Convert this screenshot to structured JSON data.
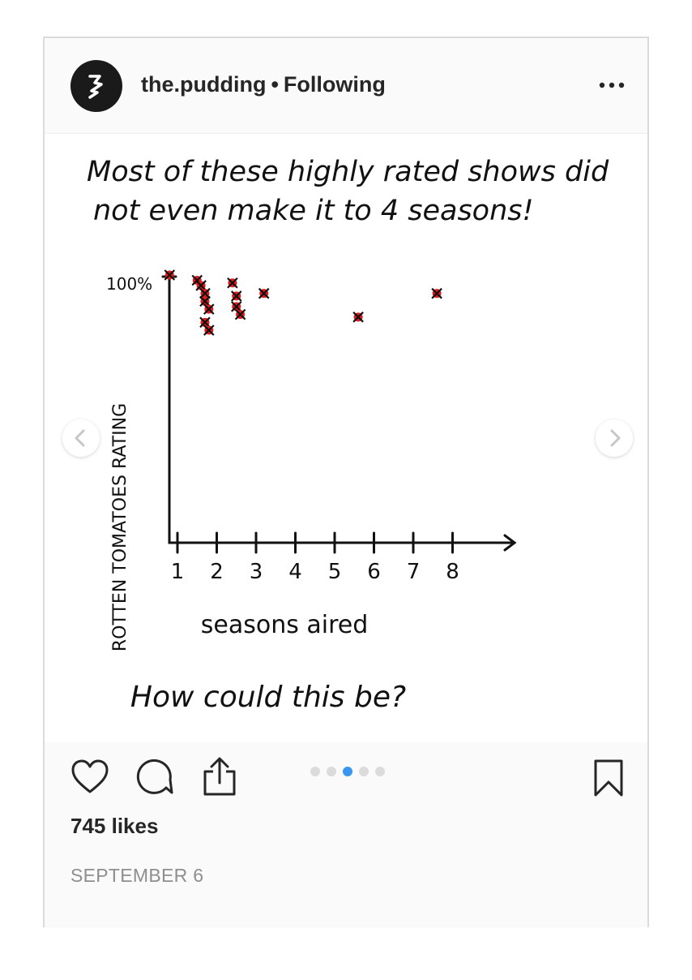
{
  "post": {
    "username": "the.pudding",
    "separator": "•",
    "follow_status": "Following",
    "likes": "745 likes",
    "date": "SEPTEMBER 6",
    "carousel": {
      "count": 5,
      "active_index": 2
    }
  },
  "image": {
    "title_line1": "Most of these highly rated shows did",
    "title_line2": "not even make it to 4 seasons!",
    "footer": "How could this be?"
  },
  "colors": {
    "accent": "#3897f0",
    "dot_red": "#e01b1b",
    "border": "#dbdbdb"
  },
  "icons": [
    "more-options-icon",
    "chevron-left-icon",
    "chevron-right-icon",
    "heart-icon",
    "comment-icon",
    "share-icon",
    "bookmark-icon"
  ],
  "chart_data": {
    "type": "scatter",
    "ylabel": "ROTTEN TOMATOES RATING",
    "xlabel": "seasons aired",
    "y_tick": "100%",
    "x_ticks": [
      "1",
      "2",
      "3",
      "4",
      "5",
      "6",
      "7",
      "8"
    ],
    "xlim": [
      0.5,
      8.5
    ],
    "ylim": [
      0,
      100
    ],
    "points": [
      {
        "x": 0.8,
        "y": 100
      },
      {
        "x": 1.5,
        "y": 98
      },
      {
        "x": 1.6,
        "y": 96
      },
      {
        "x": 1.7,
        "y": 93
      },
      {
        "x": 1.7,
        "y": 90
      },
      {
        "x": 1.8,
        "y": 87
      },
      {
        "x": 1.7,
        "y": 82
      },
      {
        "x": 1.8,
        "y": 79
      },
      {
        "x": 2.4,
        "y": 97
      },
      {
        "x": 2.5,
        "y": 92
      },
      {
        "x": 2.5,
        "y": 88
      },
      {
        "x": 2.6,
        "y": 85
      },
      {
        "x": 3.2,
        "y": 93
      },
      {
        "x": 5.6,
        "y": 84
      },
      {
        "x": 7.6,
        "y": 93
      }
    ]
  }
}
